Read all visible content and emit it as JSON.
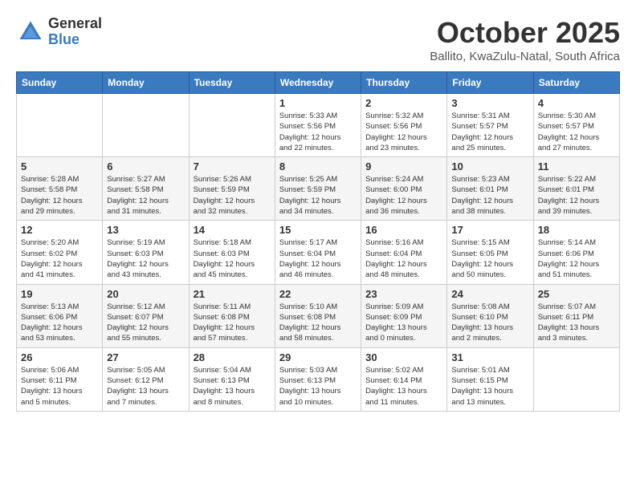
{
  "header": {
    "logo_general": "General",
    "logo_blue": "Blue",
    "month": "October 2025",
    "location": "Ballito, KwaZulu-Natal, South Africa"
  },
  "weekdays": [
    "Sunday",
    "Monday",
    "Tuesday",
    "Wednesday",
    "Thursday",
    "Friday",
    "Saturday"
  ],
  "weeks": [
    [
      {
        "day": "",
        "info": ""
      },
      {
        "day": "",
        "info": ""
      },
      {
        "day": "",
        "info": ""
      },
      {
        "day": "1",
        "info": "Sunrise: 5:33 AM\nSunset: 5:56 PM\nDaylight: 12 hours\nand 22 minutes."
      },
      {
        "day": "2",
        "info": "Sunrise: 5:32 AM\nSunset: 5:56 PM\nDaylight: 12 hours\nand 23 minutes."
      },
      {
        "day": "3",
        "info": "Sunrise: 5:31 AM\nSunset: 5:57 PM\nDaylight: 12 hours\nand 25 minutes."
      },
      {
        "day": "4",
        "info": "Sunrise: 5:30 AM\nSunset: 5:57 PM\nDaylight: 12 hours\nand 27 minutes."
      }
    ],
    [
      {
        "day": "5",
        "info": "Sunrise: 5:28 AM\nSunset: 5:58 PM\nDaylight: 12 hours\nand 29 minutes."
      },
      {
        "day": "6",
        "info": "Sunrise: 5:27 AM\nSunset: 5:58 PM\nDaylight: 12 hours\nand 31 minutes."
      },
      {
        "day": "7",
        "info": "Sunrise: 5:26 AM\nSunset: 5:59 PM\nDaylight: 12 hours\nand 32 minutes."
      },
      {
        "day": "8",
        "info": "Sunrise: 5:25 AM\nSunset: 5:59 PM\nDaylight: 12 hours\nand 34 minutes."
      },
      {
        "day": "9",
        "info": "Sunrise: 5:24 AM\nSunset: 6:00 PM\nDaylight: 12 hours\nand 36 minutes."
      },
      {
        "day": "10",
        "info": "Sunrise: 5:23 AM\nSunset: 6:01 PM\nDaylight: 12 hours\nand 38 minutes."
      },
      {
        "day": "11",
        "info": "Sunrise: 5:22 AM\nSunset: 6:01 PM\nDaylight: 12 hours\nand 39 minutes."
      }
    ],
    [
      {
        "day": "12",
        "info": "Sunrise: 5:20 AM\nSunset: 6:02 PM\nDaylight: 12 hours\nand 41 minutes."
      },
      {
        "day": "13",
        "info": "Sunrise: 5:19 AM\nSunset: 6:03 PM\nDaylight: 12 hours\nand 43 minutes."
      },
      {
        "day": "14",
        "info": "Sunrise: 5:18 AM\nSunset: 6:03 PM\nDaylight: 12 hours\nand 45 minutes."
      },
      {
        "day": "15",
        "info": "Sunrise: 5:17 AM\nSunset: 6:04 PM\nDaylight: 12 hours\nand 46 minutes."
      },
      {
        "day": "16",
        "info": "Sunrise: 5:16 AM\nSunset: 6:04 PM\nDaylight: 12 hours\nand 48 minutes."
      },
      {
        "day": "17",
        "info": "Sunrise: 5:15 AM\nSunset: 6:05 PM\nDaylight: 12 hours\nand 50 minutes."
      },
      {
        "day": "18",
        "info": "Sunrise: 5:14 AM\nSunset: 6:06 PM\nDaylight: 12 hours\nand 51 minutes."
      }
    ],
    [
      {
        "day": "19",
        "info": "Sunrise: 5:13 AM\nSunset: 6:06 PM\nDaylight: 12 hours\nand 53 minutes."
      },
      {
        "day": "20",
        "info": "Sunrise: 5:12 AM\nSunset: 6:07 PM\nDaylight: 12 hours\nand 55 minutes."
      },
      {
        "day": "21",
        "info": "Sunrise: 5:11 AM\nSunset: 6:08 PM\nDaylight: 12 hours\nand 57 minutes."
      },
      {
        "day": "22",
        "info": "Sunrise: 5:10 AM\nSunset: 6:08 PM\nDaylight: 12 hours\nand 58 minutes."
      },
      {
        "day": "23",
        "info": "Sunrise: 5:09 AM\nSunset: 6:09 PM\nDaylight: 13 hours\nand 0 minutes."
      },
      {
        "day": "24",
        "info": "Sunrise: 5:08 AM\nSunset: 6:10 PM\nDaylight: 13 hours\nand 2 minutes."
      },
      {
        "day": "25",
        "info": "Sunrise: 5:07 AM\nSunset: 6:11 PM\nDaylight: 13 hours\nand 3 minutes."
      }
    ],
    [
      {
        "day": "26",
        "info": "Sunrise: 5:06 AM\nSunset: 6:11 PM\nDaylight: 13 hours\nand 5 minutes."
      },
      {
        "day": "27",
        "info": "Sunrise: 5:05 AM\nSunset: 6:12 PM\nDaylight: 13 hours\nand 7 minutes."
      },
      {
        "day": "28",
        "info": "Sunrise: 5:04 AM\nSunset: 6:13 PM\nDaylight: 13 hours\nand 8 minutes."
      },
      {
        "day": "29",
        "info": "Sunrise: 5:03 AM\nSunset: 6:13 PM\nDaylight: 13 hours\nand 10 minutes."
      },
      {
        "day": "30",
        "info": "Sunrise: 5:02 AM\nSunset: 6:14 PM\nDaylight: 13 hours\nand 11 minutes."
      },
      {
        "day": "31",
        "info": "Sunrise: 5:01 AM\nSunset: 6:15 PM\nDaylight: 13 hours\nand 13 minutes."
      },
      {
        "day": "",
        "info": ""
      }
    ]
  ]
}
